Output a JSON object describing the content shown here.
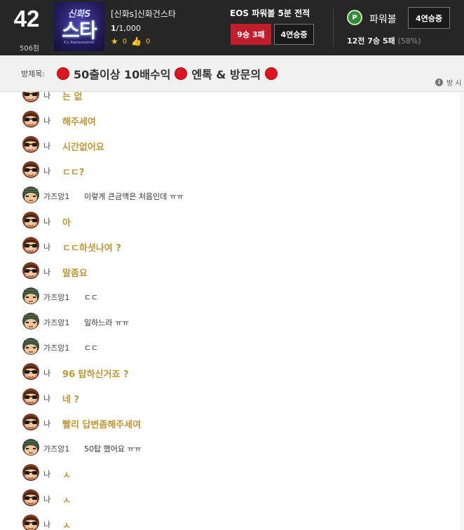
{
  "header": {
    "level": "42",
    "points": "506점",
    "logo_line1": "신화S",
    "logo_line2": "스타",
    "logo_line3": "K.L.Paeramestres",
    "room_title": "[신화s]신화건스타",
    "room_count_current": "1",
    "room_count_total": "/1,000",
    "stars": "0",
    "likes": "0",
    "eos_title": "EOS 파워볼 5분 전적",
    "eos_record": "9승 3패",
    "eos_streak": "4연승중",
    "pb_icon": "P",
    "pb_name": "파워볼",
    "pb_streak": "4연승중",
    "pb_summary": "12전 7승 5패",
    "pb_pct": "(58%)"
  },
  "notice": {
    "label": "방제목:",
    "seg1": "50출이상 10배수익",
    "seg2": "엔톡 & 방문의",
    "info": "방 시"
  },
  "colors": {
    "header_bg": "#262626",
    "record_red": "#c11d2a",
    "my_text": "#bf9633",
    "dot_red": "#e0141e"
  },
  "messages": [
    {
      "kind": "mine",
      "sender": "나",
      "text": "는 없"
    },
    {
      "kind": "mine",
      "sender": "나",
      "text": "해주세여"
    },
    {
      "kind": "mine",
      "sender": "나",
      "text": "시간없어요"
    },
    {
      "kind": "mine",
      "sender": "나",
      "text": "ㄷㄷ?"
    },
    {
      "kind": "other",
      "sender": "가즈앙1",
      "text": "이렇게 큰금액은 처음인데 ㅠㅠ"
    },
    {
      "kind": "mine",
      "sender": "나",
      "text": "아"
    },
    {
      "kind": "mine",
      "sender": "나",
      "text": "ㄷㄷ하셧나여 ?"
    },
    {
      "kind": "mine",
      "sender": "나",
      "text": "말좀요"
    },
    {
      "kind": "other",
      "sender": "가즈앙1",
      "text": "ㄷㄷ"
    },
    {
      "kind": "other",
      "sender": "가즈앙1",
      "text": "일하느라 ㅠㅠ"
    },
    {
      "kind": "other",
      "sender": "가즈앙1",
      "text": "ㄷㄷ"
    },
    {
      "kind": "mine",
      "sender": "나",
      "text": "96 탑하신거죠 ?"
    },
    {
      "kind": "mine",
      "sender": "나",
      "text": "네 ?"
    },
    {
      "kind": "mine",
      "sender": "나",
      "text": "빨리 답변좀해주세여"
    },
    {
      "kind": "other",
      "sender": "가즈앙1",
      "text": "50탑 했어요 ㅠㅠ"
    },
    {
      "kind": "mine",
      "sender": "나",
      "text": "ㅅ"
    },
    {
      "kind": "mine",
      "sender": "나",
      "text": "ㅅ"
    },
    {
      "kind": "mine",
      "sender": "나",
      "text": "ㅅ"
    }
  ]
}
